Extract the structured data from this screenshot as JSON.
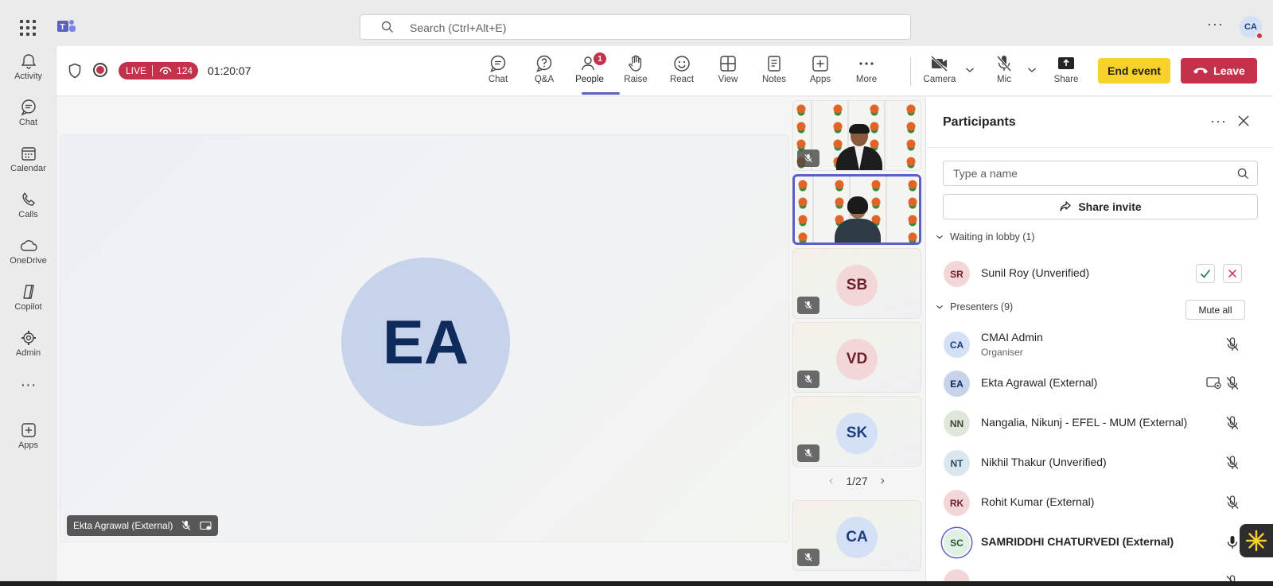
{
  "search": {
    "placeholder": "Search (Ctrl+Alt+E)"
  },
  "user": {
    "initials": "CA"
  },
  "rail": [
    {
      "label": "Activity",
      "icon": "bell-icon"
    },
    {
      "label": "Chat",
      "icon": "chat-icon"
    },
    {
      "label": "Calendar",
      "icon": "calendar-icon"
    },
    {
      "label": "Calls",
      "icon": "phone-icon"
    },
    {
      "label": "OneDrive",
      "icon": "cloud-icon"
    },
    {
      "label": "Copilot",
      "icon": "copilot-icon"
    },
    {
      "label": "Admin",
      "icon": "admin-icon"
    },
    {
      "label": "Apps",
      "icon": "apps-add-icon"
    }
  ],
  "meeting": {
    "live_label": "LIVE",
    "viewer_count": "124",
    "timer": "01:20:07",
    "people_badge": "1",
    "buttons": {
      "chat": "Chat",
      "qa": "Q&A",
      "people": "People",
      "raise": "Raise",
      "react": "React",
      "view": "View",
      "notes": "Notes",
      "apps": "Apps",
      "more": "More",
      "camera": "Camera",
      "mic": "Mic",
      "share": "Share"
    },
    "end_event": "End event",
    "leave": "Leave",
    "accent": "#5b5fc7",
    "leave_color": "#c4314b",
    "end_color": "#f8d22a"
  },
  "stage": {
    "main_initials": "EA",
    "main_name": "Ekta Agrawal (External)",
    "gallery": [
      {
        "initials": "SB",
        "bg": "#f3d6d8",
        "fg": "#6e1f2b"
      },
      {
        "initials": "VD",
        "bg": "#f3d6d8",
        "fg": "#6e1f2b"
      },
      {
        "initials": "SK",
        "bg": "#d4e0f5",
        "fg": "#1b3d7a"
      },
      {
        "initials": "CA",
        "bg": "#d4e0f5",
        "fg": "#1b3d7a"
      }
    ],
    "page": "1/27"
  },
  "participants": {
    "title": "Participants",
    "search_placeholder": "Type a name",
    "share_invite": "Share invite",
    "lobby_header": "Waiting in lobby (1)",
    "lobby": [
      {
        "initials": "SR",
        "name": "Sunil Roy (Unverified)",
        "bg": "#f3d6d8",
        "fg": "#6e1f2b"
      }
    ],
    "presenters_header": "Presenters (9)",
    "mute_all": "Mute all",
    "presenters": [
      {
        "initials": "CA",
        "name": "CMAI Admin",
        "sub": "Organiser",
        "bg": "#d4e0f5",
        "fg": "#1b3d7a"
      },
      {
        "initials": "EA",
        "name": "Ekta Agrawal (External)",
        "bg": "#c7d3ea",
        "fg": "#0f2b5b"
      },
      {
        "initials": "NN",
        "name": "Nangalia, Nikunj - EFEL - MUM (External)",
        "bg": "#dfe6da",
        "fg": "#3b4a30"
      },
      {
        "initials": "NT",
        "name": "Nikhil Thakur (Unverified)",
        "bg": "#dbe7ee",
        "fg": "#2a4c5e"
      },
      {
        "initials": "RK",
        "name": "Rohit Kumar (External)",
        "bg": "#f3d6d8",
        "fg": "#6e1f2b"
      },
      {
        "initials": "SC",
        "name": "SAMRIDDHI CHATURVEDI (External)",
        "bg": "#e0f0e4",
        "fg": "#235c33"
      }
    ]
  }
}
